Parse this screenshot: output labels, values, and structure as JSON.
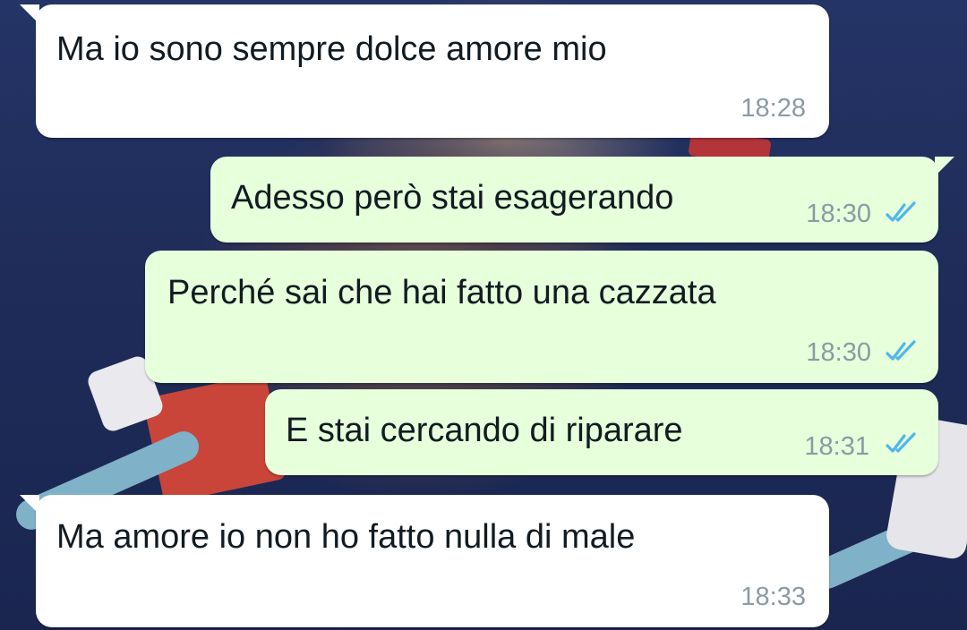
{
  "chat": {
    "messages": [
      {
        "direction": "incoming",
        "text": "Ma io sono sempre dolce amore mio",
        "time": "18:28"
      },
      {
        "direction": "outgoing",
        "text": "Adesso però stai esagerando",
        "time": "18:30",
        "status": "read"
      },
      {
        "direction": "outgoing",
        "text": "Perché sai che hai fatto una cazzata",
        "time": "18:30",
        "status": "read"
      },
      {
        "direction": "outgoing",
        "text": "E stai cercando di riparare",
        "time": "18:31",
        "status": "read"
      },
      {
        "direction": "incoming",
        "text": "Ma amore io non ho fatto nulla di male",
        "time": "18:33"
      }
    ]
  },
  "colors": {
    "incoming_bubble": "#ffffff",
    "outgoing_bubble": "#e7ffdb",
    "read_tick": "#4fb6ec",
    "timestamp": "#8c9aa3"
  },
  "icons": {
    "read_receipt": "double-check-icon"
  }
}
